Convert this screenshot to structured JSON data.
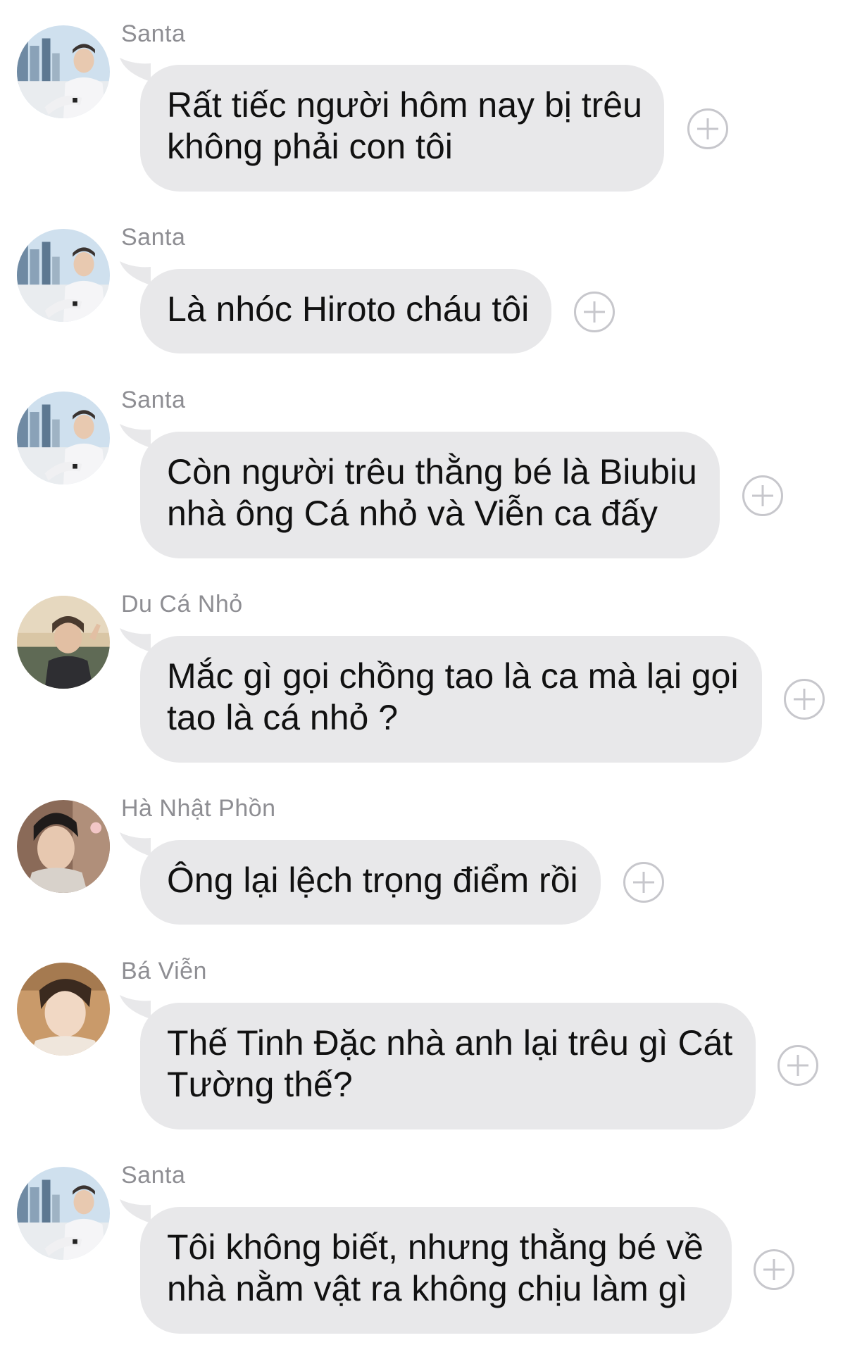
{
  "messages": [
    {
      "sender": "Santa",
      "line1": "Rất tiếc người hôm nay bị trêu",
      "line2": "không phải con tôi",
      "avatar_icon": "santa-avatar-icon"
    },
    {
      "sender": "Santa",
      "line1": "Là nhóc Hiroto cháu tôi",
      "line2": "",
      "avatar_icon": "santa-avatar-icon"
    },
    {
      "sender": "Santa",
      "line1": "Còn người trêu thằng bé là Biubiu",
      "line2": "nhà ông Cá nhỏ và Viễn ca đấy",
      "avatar_icon": "santa-avatar-icon"
    },
    {
      "sender": "Du Cá Nhỏ",
      "line1": "Mắc gì gọi chồng tao là ca mà lại gọi",
      "line2": "tao là cá nhỏ ?",
      "avatar_icon": "du-ca-nho-avatar-icon"
    },
    {
      "sender": "Hà Nhật Phồn",
      "line1": "Ông lại lệch trọng điểm rồi",
      "line2": "",
      "avatar_icon": "ha-nhat-phon-avatar-icon"
    },
    {
      "sender": "Bá Viễn",
      "line1": "Thế Tinh Đặc nhà anh lại trêu gì Cát",
      "line2": "Tường thế?",
      "avatar_icon": "ba-vien-avatar-icon"
    },
    {
      "sender": "Santa",
      "line1": "Tôi không biết, nhưng thằng bé về",
      "line2": "nhà nằm vật ra không chịu làm gì",
      "avatar_icon": "santa-avatar-icon"
    }
  ],
  "colors": {
    "bubble": "#e8e8ea",
    "sender_text": "#8e8e93",
    "message_text": "#111111",
    "plus_icon": "#c7c7cc"
  }
}
